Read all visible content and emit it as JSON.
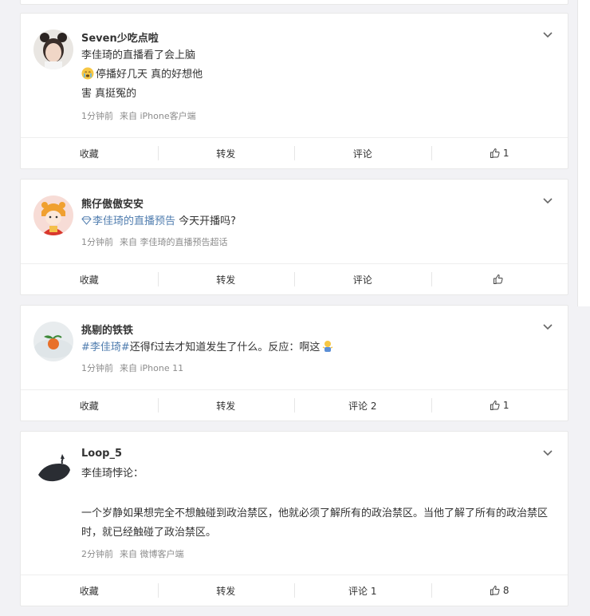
{
  "posts": [
    {
      "author": "Seven少吃点啦",
      "lines": [
        "李佳琦的直播看了会上脑",
        "停播好几天 真的好想他",
        "害 真挺冤的"
      ],
      "time": "1分钟前",
      "source": "来自 iPhone客户端",
      "actions": {
        "favorite": "收藏",
        "repost": "转发",
        "comment": "评论",
        "like_count": "1"
      }
    },
    {
      "author": "熊仔傲傲安安",
      "topic": "李佳琦的直播预告",
      "text_after": " 今天开播吗?",
      "time": "1分钟前",
      "source": "来自 李佳琦的直播预告超话",
      "actions": {
        "favorite": "收藏",
        "repost": "转发",
        "comment": "评论",
        "like_count": ""
      }
    },
    {
      "author": "挑剔的铁铁",
      "hashtag": "#李佳琦#",
      "text_after": "还得f过去才知道发生了什么。反应：啊这",
      "time": "1分钟前",
      "source": "来自 iPhone 11",
      "actions": {
        "favorite": "收藏",
        "repost": "转发",
        "comment": "评论 2",
        "like_count": "1"
      }
    },
    {
      "author": "Loop_5",
      "line1": "李佳琦悖论：",
      "paragraph": "一个岁静如果想完全不想触碰到政治禁区，他就必须了解所有的政治禁区。当他了解了所有的政治禁区时，就已经触碰了政治禁区。",
      "time": "2分钟前",
      "source": "来自 微博客户端",
      "actions": {
        "favorite": "收藏",
        "repost": "转发",
        "comment": "评论 1",
        "like_count": "8"
      }
    }
  ],
  "icons": {
    "dropdown": "chevron-down-icon",
    "like": "thumbs-up-icon",
    "supertopic": "diamond-icon",
    "emoji": "crying-face-icon"
  }
}
